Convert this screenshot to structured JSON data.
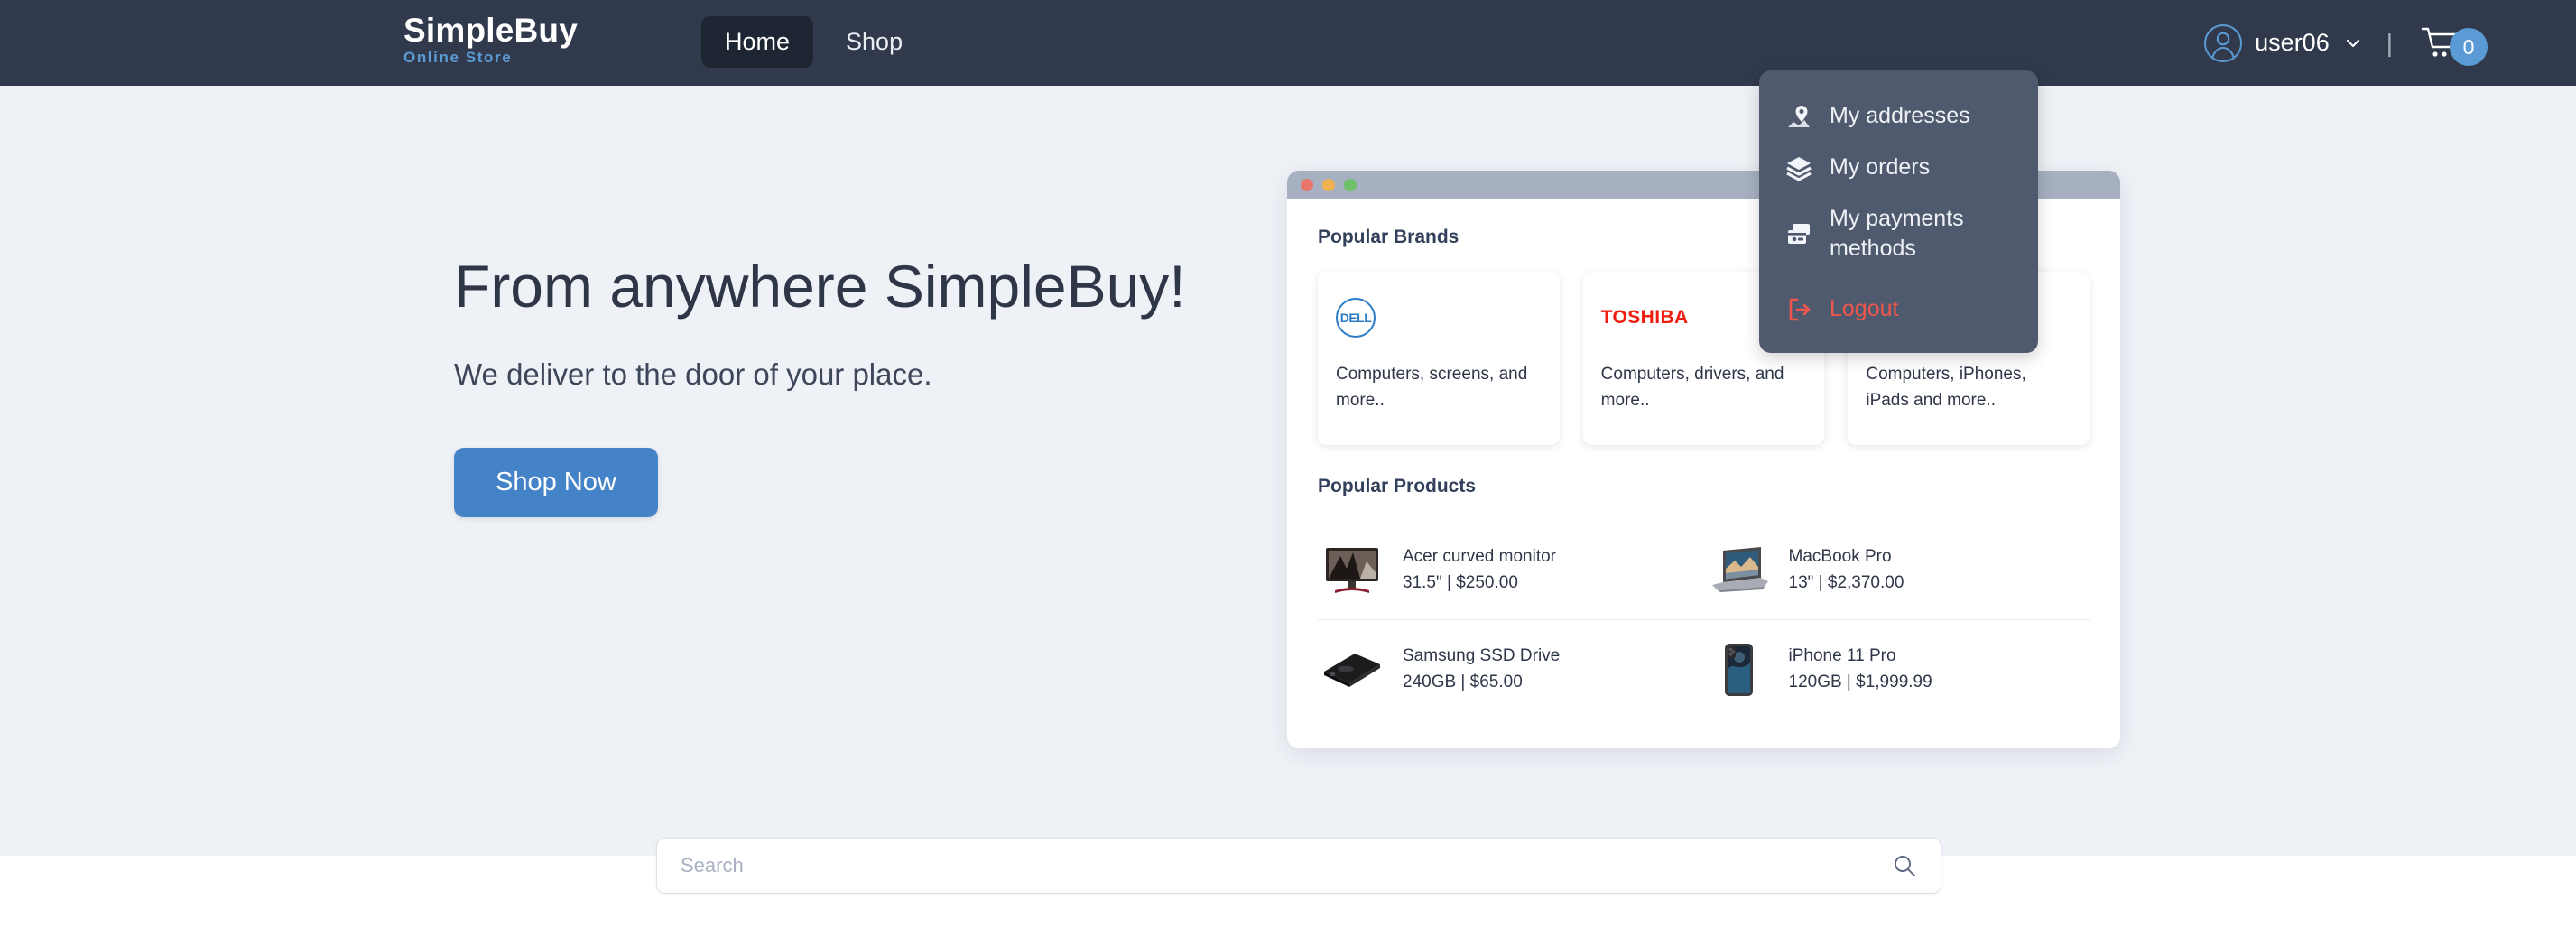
{
  "header": {
    "brand_name": "SimpleBuy",
    "brand_subtitle": "Online Store",
    "nav": [
      {
        "label": "Home",
        "active": true
      },
      {
        "label": "Shop",
        "active": false
      }
    ],
    "user_name": "user06",
    "divider": "|",
    "cart_count": "0"
  },
  "user_dropdown": {
    "items": [
      {
        "label": "My addresses",
        "icon": "map-pin-icon"
      },
      {
        "label": "My orders",
        "icon": "layers-icon"
      },
      {
        "label": "My payments methods",
        "icon": "credit-card-icon"
      },
      {
        "label": "Logout",
        "icon": "logout-icon"
      }
    ]
  },
  "hero": {
    "title": "From anywhere SimpleBuy!",
    "subtitle": "We deliver to the door of your place.",
    "cta_label": "Shop Now"
  },
  "card": {
    "brands_title": "Popular Brands",
    "brands": [
      {
        "logo": "dell-logo",
        "logo_text": "DELL",
        "description": "Computers, screens, and more.."
      },
      {
        "logo": "toshiba-logo",
        "logo_text": "TOSHIBA",
        "description": "Computers, drivers, and more.."
      },
      {
        "logo": "apple-logo",
        "logo_text": "",
        "description": "Computers, iPhones, iPads and more.."
      }
    ],
    "products_title": "Popular Products",
    "products": [
      {
        "name": "Acer curved monitor",
        "specs": "31.5\" | $250.00",
        "thumb": "monitor-thumb"
      },
      {
        "name": "MacBook Pro",
        "specs": "13\" | $2,370.00",
        "thumb": "laptop-thumb"
      },
      {
        "name": "Samsung SSD Drive",
        "specs": "240GB | $65.00",
        "thumb": "ssd-thumb"
      },
      {
        "name": "iPhone 11 Pro",
        "specs": "120GB | $1,999.99",
        "thumb": "phone-thumb"
      }
    ]
  },
  "search": {
    "placeholder": "Search",
    "value": ""
  },
  "colors": {
    "navbar_bg": "#313a4c",
    "nav_active_bg": "#1e2533",
    "accent_blue": "#4483c8",
    "brand_sub_blue": "#5b9bd5",
    "hero_bg": "#eef1f6",
    "dropdown_bg": "#505a6e",
    "logout_red": "#f0564b",
    "toshiba_red": "#f01c10",
    "dell_blue": "#2b7cc4"
  }
}
